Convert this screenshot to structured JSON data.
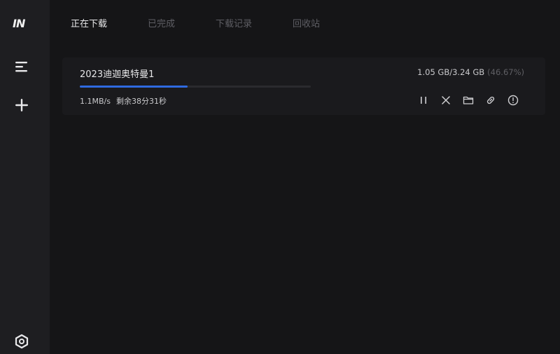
{
  "app": {
    "logo_text": "IN"
  },
  "sidebar": {
    "items": [
      {
        "name": "menu-icon"
      },
      {
        "name": "plus-icon"
      },
      {
        "name": "settings-hex-icon"
      }
    ]
  },
  "tabs": [
    {
      "label": "正在下载",
      "active": true
    },
    {
      "label": "已完成",
      "active": false
    },
    {
      "label": "下载记录",
      "active": false
    },
    {
      "label": "回收站",
      "active": false
    }
  ],
  "download": {
    "name": "2023迪迦奥特曼1",
    "size_text": "1.05 GB/3.24 GB",
    "percent_text": "(46.67%)",
    "progress": 0.4667,
    "speed": "1.1MB/s",
    "remaining": "剩余38分31秒",
    "actions": [
      "pause-icon",
      "close-icon",
      "folder-icon",
      "link-icon",
      "info-icon"
    ]
  },
  "colors": {
    "accent": "#2f6ae0",
    "background": "#151517",
    "sidebar": "#1e1e21"
  }
}
